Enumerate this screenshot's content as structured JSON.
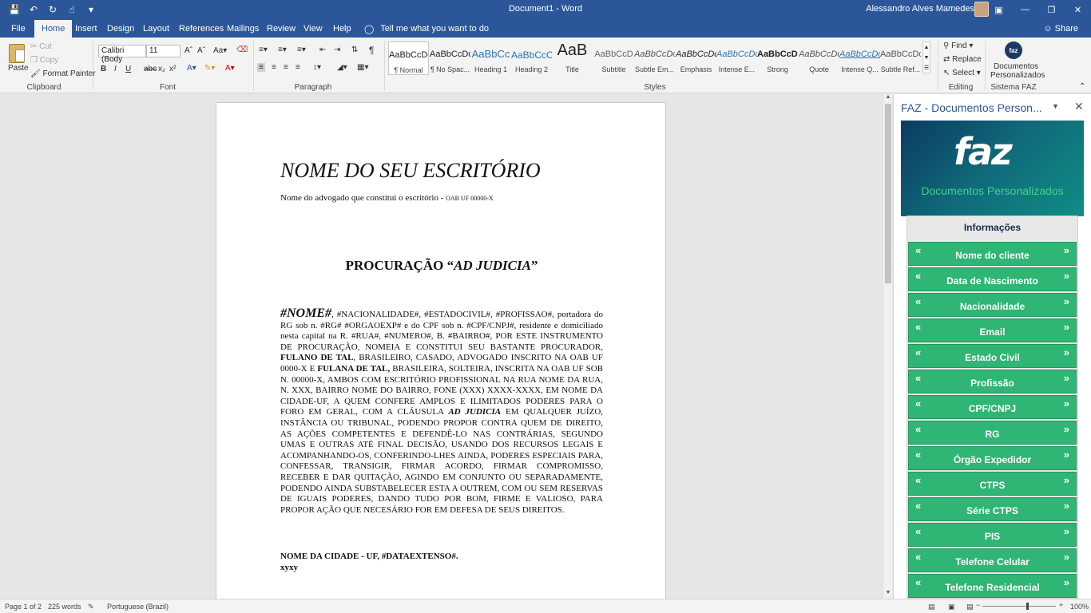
{
  "titlebar": {
    "doc_title": "Document1 - Word",
    "user": "Alessandro Alves Mamedes",
    "qat": [
      "save-icon",
      "undo-icon",
      "redo-icon",
      "touch-mode-icon",
      "customize-icon"
    ]
  },
  "tabs": [
    "File",
    "Home",
    "Insert",
    "Design",
    "Layout",
    "References",
    "Mailings",
    "Review",
    "View",
    "Help"
  ],
  "active_tab": "Home",
  "tellme": "Tell me what you want to do",
  "share": "Share",
  "ribbon": {
    "clipboard": {
      "paste": "Paste",
      "cut": "Cut",
      "copy": "Copy",
      "format_painter": "Format Painter",
      "label": "Clipboard"
    },
    "font": {
      "name": "Calibri (Body",
      "size": "11",
      "label": "Font"
    },
    "paragraph": {
      "label": "Paragraph"
    },
    "styles": {
      "label": "Styles",
      "items": [
        {
          "preview": "AaBbCcDc",
          "name": "¶ Normal"
        },
        {
          "preview": "AaBbCcDc",
          "name": "¶ No Spac..."
        },
        {
          "preview": "AaBbCc",
          "name": "Heading 1"
        },
        {
          "preview": "AaBbCcC",
          "name": "Heading 2"
        },
        {
          "preview": "AaB",
          "name": "Title"
        },
        {
          "preview": "AaBbCcD",
          "name": "Subtitle"
        },
        {
          "preview": "AaBbCcDc",
          "name": "Subtle Em..."
        },
        {
          "preview": "AaBbCcDc",
          "name": "Emphasis"
        },
        {
          "preview": "AaBbCcDc",
          "name": "Intense E..."
        },
        {
          "preview": "AaBbCcDc",
          "name": "Strong"
        },
        {
          "preview": "AaBbCcDc",
          "name": "Quote"
        },
        {
          "preview": "AaBbCcDc",
          "name": "Intense Q..."
        },
        {
          "preview": "AaBbCcDc",
          "name": "Subtle Ref..."
        }
      ]
    },
    "editing": {
      "find": "Find",
      "replace": "Replace",
      "select": "Select",
      "label": "Editing"
    },
    "faz": {
      "btn1": "Documentos",
      "btn2": "Personalizados",
      "label": "Sistema FAZ",
      "logo": "faz"
    }
  },
  "document": {
    "office_name": "NOME DO SEU ESCRITÓRIO",
    "lawyer_line": "Nome do advogado que constitui o escritório - ",
    "lawyer_oab": "OAB UF 00000-X",
    "title_plain": "PROCURAÇÃO “",
    "title_italic": "AD JUDICIA",
    "title_end": "”",
    "nome_tag": "#NOME#",
    "p1": ", #NACIONALIDADE#, #ESTADOCIVIL#, #PROFISSAO#, portadora do RG sob n. #RG# #ORGAOEXP# e do CPF sob n. #CPF/CNPJ#, residente e domiciliado nesta capital na R. #RUA#, #NUMERO#, B. #BAIRRO#, POR ESTE INSTRUMENTO DE PROCURAÇÃO, NOMEIA E CONSTITUI SEU BASTANTE PROCURADOR, ",
    "b1": "FULANO DE TAL",
    "p2": ", BRASILEIRO, CASADO, ADVOGADO INSCRITO NA OAB UF 0000-X E ",
    "b2": "FULANA DE TAL,",
    "p3": " BRASILEIRA, SOLTEIRA, INSCRITA NA OAB UF SOB N. 00000-X, AMBOS COM ESCRITÓRIO PROFISSIONAL NA RUA NOME DA RUA, N. XXX, BAIRRO NOME DO BAIRRO, FONE (XXX) XXXX-XXXX, EM NOME DA CIDADE-UF, A QUEM CONFERE AMPLOS E ILIMITADOS PODERES PARA O FORO EM GERAL, COM A CLÁUSULA ",
    "bi1": "AD JUDICIA",
    "p4": " EM QUALQUER JUÍZO, INSTÂNCIA OU TRIBUNAL, PODENDO PROPOR CONTRA QUEM DE DIREITO, AS AÇÕES COMPETENTES E DEFENDÊ-LO NAS CONTRÁRIAS, SEGUNDO UMAS E OUTRAS ATÉ FINAL DECISÃO, USANDO DOS RECURSOS LEGAIS E ACOMPANHANDO-OS, CONFERINDO-LHES AINDA, PODERES ESPECIAIS PARA, CONFESSAR, TRANSIGIR, FIRMAR ACORDO, FIRMAR COMPROMISSO, RECEBER E DAR QUITAÇÃO, AGINDO EM CONJUNTO OU SEPARADAMENTE, PODENDO AINDA SUBSTABELECER ESTA A OUTREM, COM OU SEM RESERVAS DE IGUAIS PODERES, DANDO TUDO POR BOM, FIRME E VALIOSO, PARA PROPOR AÇÃO QUE NECESÁRIO FOR EM DEFESA DE SEUS DIREITOS.",
    "city": "NOME DA CIDADE - UF, #DATAEXTENSO#.",
    "xyxy": "xyxy"
  },
  "pane": {
    "title": "FAZ - Documentos Person...",
    "brand": "faz",
    "subtitle": "Documentos Personalizados",
    "header": "Informações",
    "fields": [
      "Nome do cliente",
      "Data de Nascimento",
      "Nacionalidade",
      "Email",
      "Estado Civil",
      "Profissão",
      "CPF/CNPJ",
      "RG",
      "Órgão Expedidor",
      "CTPS",
      "Série CTPS",
      "PIS",
      "Telefone Celular",
      "Telefone Residencial"
    ],
    "arrow_left": "«",
    "arrow_right": "»"
  },
  "status": {
    "page": "Page 1 of 2",
    "words": "225 words",
    "language": "Portuguese (Brazil)",
    "zoom": "100%"
  },
  "colors": {
    "word_blue": "#2b579a",
    "faz_green": "#2fb574",
    "faz_teal": "#0f8d86"
  }
}
